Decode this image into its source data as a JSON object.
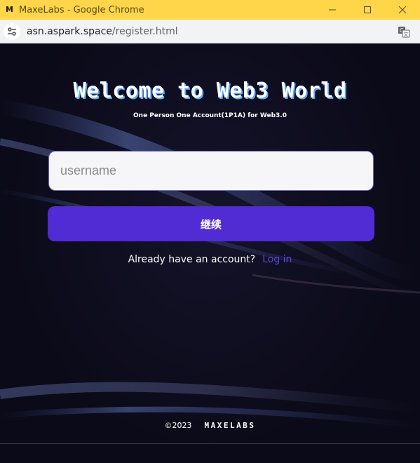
{
  "window": {
    "logo_glyph": "M",
    "title": "MaxeLabs - Google Chrome"
  },
  "addressbar": {
    "host": "asn.aspark.space",
    "path": "/register.html"
  },
  "page": {
    "heading": "Welcome to Web3 World",
    "subheading": "One Person One Account(1P1A) for Web3.0",
    "username_placeholder": "username",
    "continue_label": "继续",
    "login_prompt": "Already have an account?",
    "login_link": "Log in",
    "copyright": "©2023",
    "brand": "MAXELABS"
  },
  "colors": {
    "titlebar": "#ffd54a",
    "accent": "#512bd4",
    "background": "#0b0a18"
  }
}
